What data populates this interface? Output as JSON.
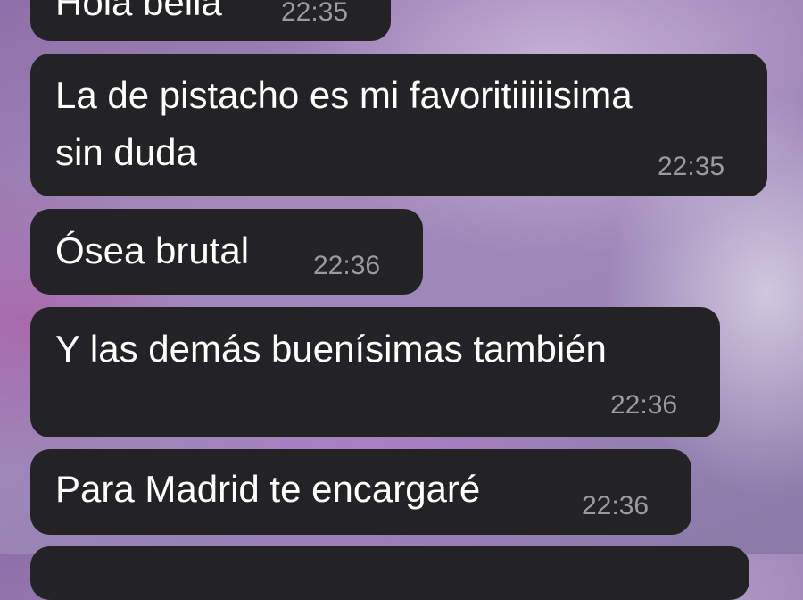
{
  "messages": [
    {
      "text": "Hola bella",
      "time": "22:35"
    },
    {
      "text_line1": "La de pistacho es mi favoritiiiiisima",
      "text_line2": "sin duda",
      "time": "22:35"
    },
    {
      "text": "Ósea brutal",
      "time": "22:36"
    },
    {
      "text": "Y las demás buenísimas también",
      "time": "22:36"
    },
    {
      "text": "Para Madrid te encargaré",
      "time": "22:36"
    }
  ],
  "colors": {
    "bubble": "#232325",
    "text": "#ffffff",
    "timestamp": "#9a9a9f"
  }
}
